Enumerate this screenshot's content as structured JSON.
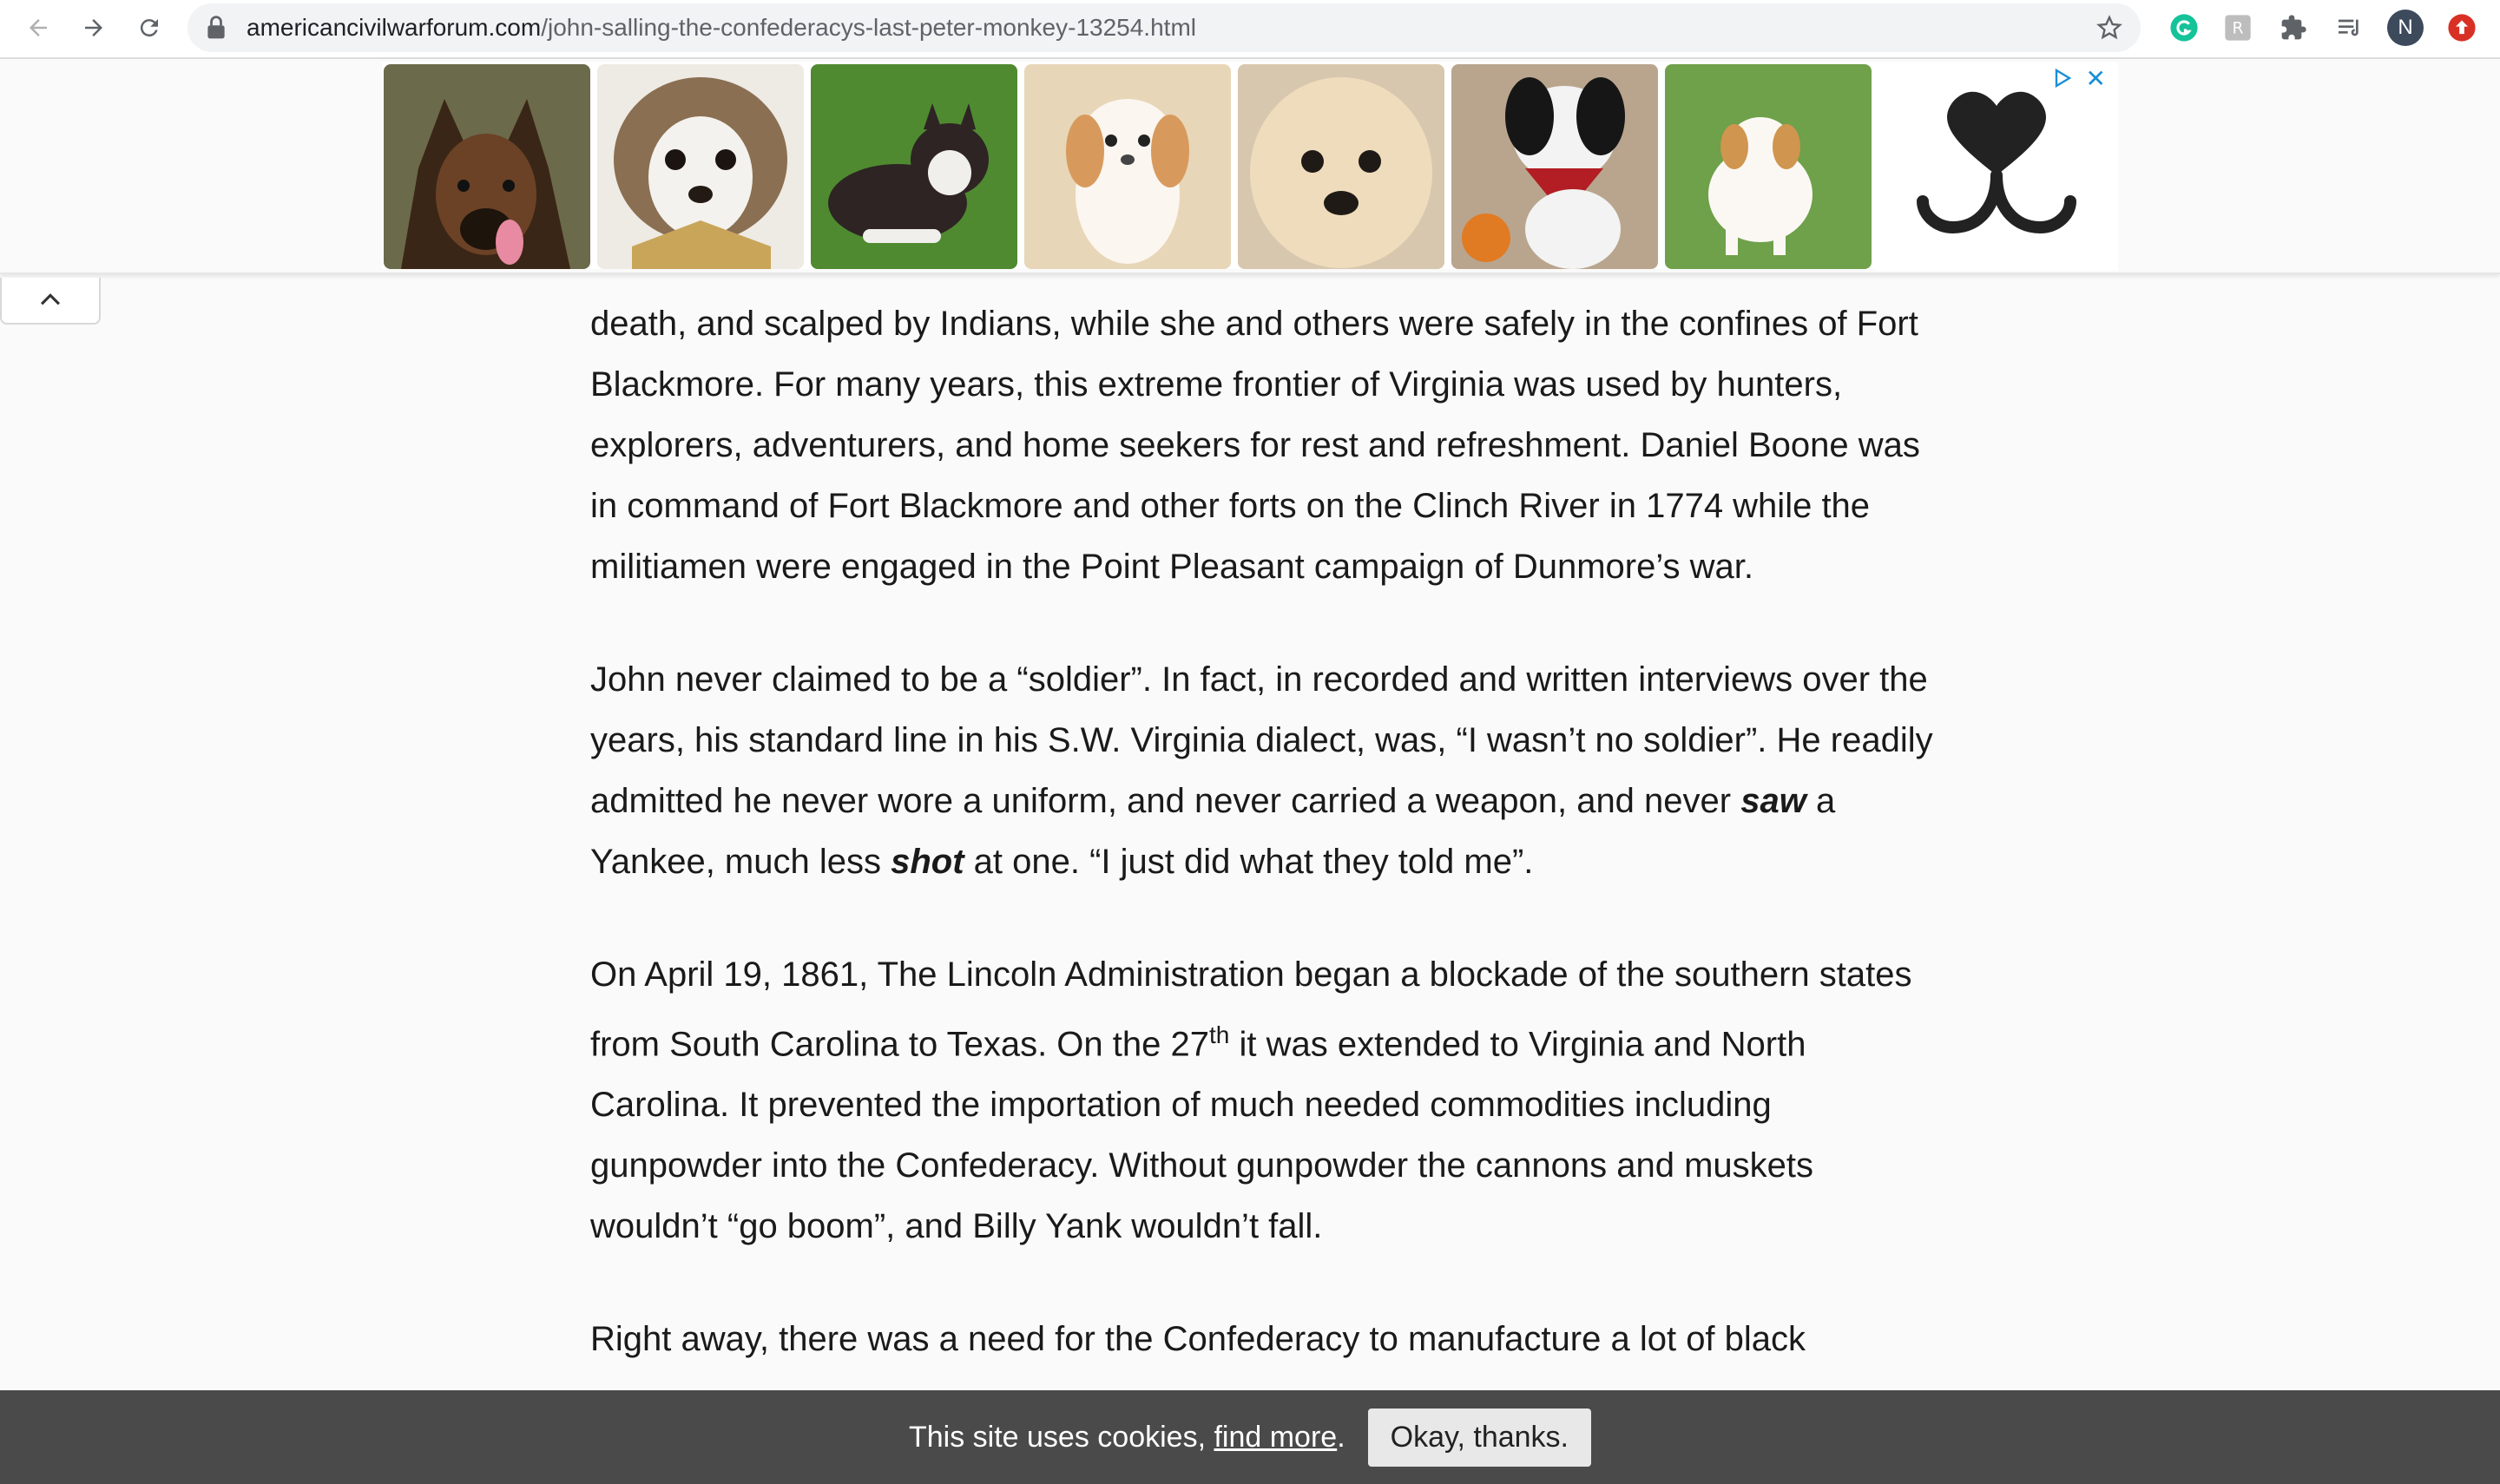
{
  "browser": {
    "url_domain": "americancivilwarforum.com",
    "url_path": "/john-salling-the-confederacys-last-peter-monkey-13254.html",
    "avatar_initial": "N",
    "icons": [
      "back-arrow-icon",
      "forward-arrow-icon",
      "reload-icon",
      "lock-icon",
      "star-icon",
      "grammarly-icon",
      "extension-icon",
      "puzzle-icon",
      "reading-list-icon",
      "update-icon"
    ]
  },
  "ad": {
    "thumbnails": [
      "german-shepherd-puppy",
      "shih-tzu-puppy",
      "husky-puppy",
      "cavalier-puppy",
      "maltipoo-puppy",
      "bernedoodle-puppy",
      "cavachon-puppy"
    ],
    "close_label": "✕",
    "logo": "dog-nose-heart-logo"
  },
  "article": {
    "p1": "death, and scalped by Indians, while she and others were safely in the confines of Fort Blackmore. For many years, this extreme frontier of Virginia was used by hunters, explorers, adventurers, and home seekers for rest and refreshment. Daniel Boone was in command of Fort Blackmore and other forts on the Clinch River in 1774 while the militiamen were engaged in the Point Pleasant campaign of Dunmore’s war.",
    "p2_a": "John never claimed to be a “soldier”. In fact, in recorded and written interviews over the years, his standard line in his S.W. Virginia dialect, was, “I wasn’t no soldier”. He readily admitted he never wore a uniform, and never carried a weapon, and never ",
    "p2_saw": "saw",
    "p2_b": " a Yankee, much less ",
    "p2_shot": "shot",
    "p2_c": " at one. “I just did what they told me”.",
    "p3_a": "On April 19, 1861, The Lincoln Administration began a blockade of the southern states from South Carolina to Texas. On the 27",
    "p3_sup": "th",
    "p3_b": " it was extended to Virginia and North Carolina. It prevented the importation of much needed commodities including gunpowder into the Confederacy. Without gunpowder the cannons and muskets wouldn’t “go boom”, and Billy Yank wouldn’t fall.",
    "p4": "Right away, there was a need for the Confederacy to manufacture a lot of black"
  },
  "cookie": {
    "text": "This site uses cookies, ",
    "link": "find more",
    "period": ".",
    "button": "Okay, thanks."
  }
}
